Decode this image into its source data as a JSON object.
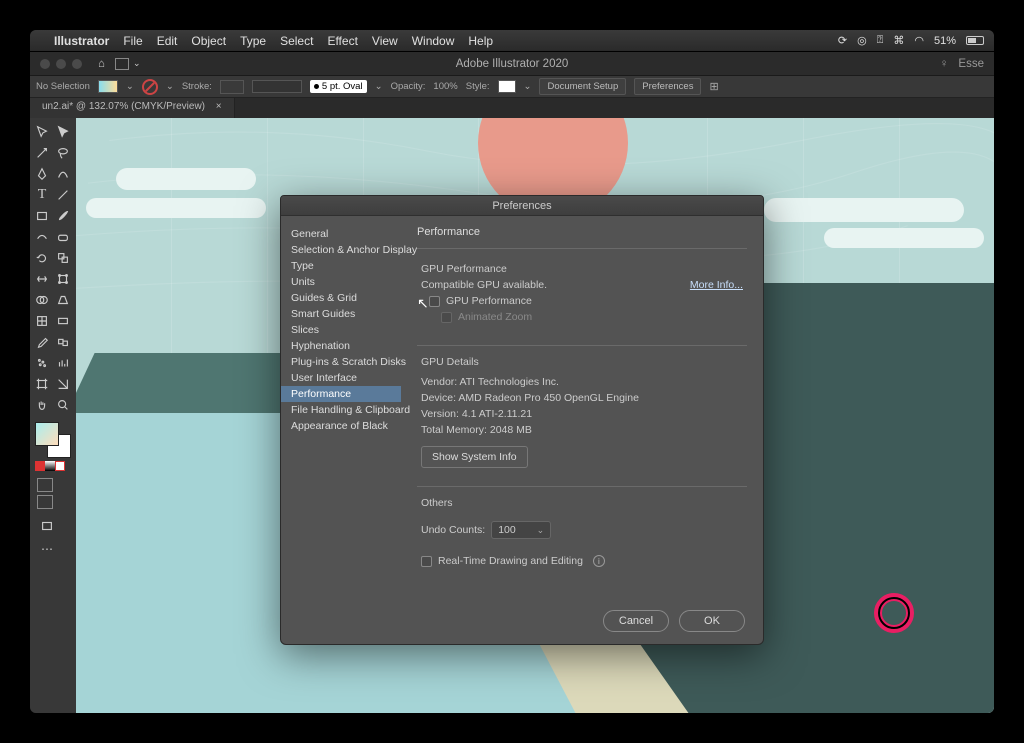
{
  "mac_menu": {
    "app": "Illustrator",
    "items": [
      "File",
      "Edit",
      "Object",
      "Type",
      "Select",
      "Effect",
      "View",
      "Window",
      "Help"
    ],
    "battery": "51%"
  },
  "app_header": {
    "title": "Adobe Illustrator 2020",
    "workspace": "Esse"
  },
  "ctrl": {
    "no_sel": "No Selection",
    "stroke": "Stroke:",
    "brush": "5 pt. Oval",
    "opacity_l": "Opacity:",
    "opacity_v": "100%",
    "style_l": "Style:",
    "doc_setup": "Document Setup",
    "prefs": "Preferences"
  },
  "doc_tab": "un2.ai* @ 132.07% (CMYK/Preview)",
  "prefs": {
    "title": "Preferences",
    "side": [
      "General",
      "Selection & Anchor Display",
      "Type",
      "Units",
      "Guides & Grid",
      "Smart Guides",
      "Slices",
      "Hyphenation",
      "Plug-ins & Scratch Disks",
      "User Interface",
      "Performance",
      "File Handling & Clipboard",
      "Appearance of Black"
    ],
    "side_sel": 10,
    "panel_title": "Performance",
    "gpu": {
      "heading": "GPU Performance",
      "compat": "Compatible GPU available.",
      "more": "More Info...",
      "cb_gpu": "GPU Performance",
      "cb_zoom": "Animated Zoom"
    },
    "details": {
      "heading": "GPU Details",
      "vendor_l": "Vendor:",
      "vendor_v": "ATI Technologies Inc.",
      "device_l": "Device:",
      "device_v": "AMD Radeon Pro 450 OpenGL Engine",
      "version_l": "Version:",
      "version_v": "4.1 ATI-2.11.21",
      "mem_l": "Total Memory:",
      "mem_v": "2048 MB",
      "sys_btn": "Show System Info"
    },
    "others": {
      "heading": "Others",
      "undo_l": "Undo Counts:",
      "undo_v": "100",
      "rt_l": "Real-Time Drawing and Editing"
    },
    "cancel": "Cancel",
    "ok": "OK"
  }
}
